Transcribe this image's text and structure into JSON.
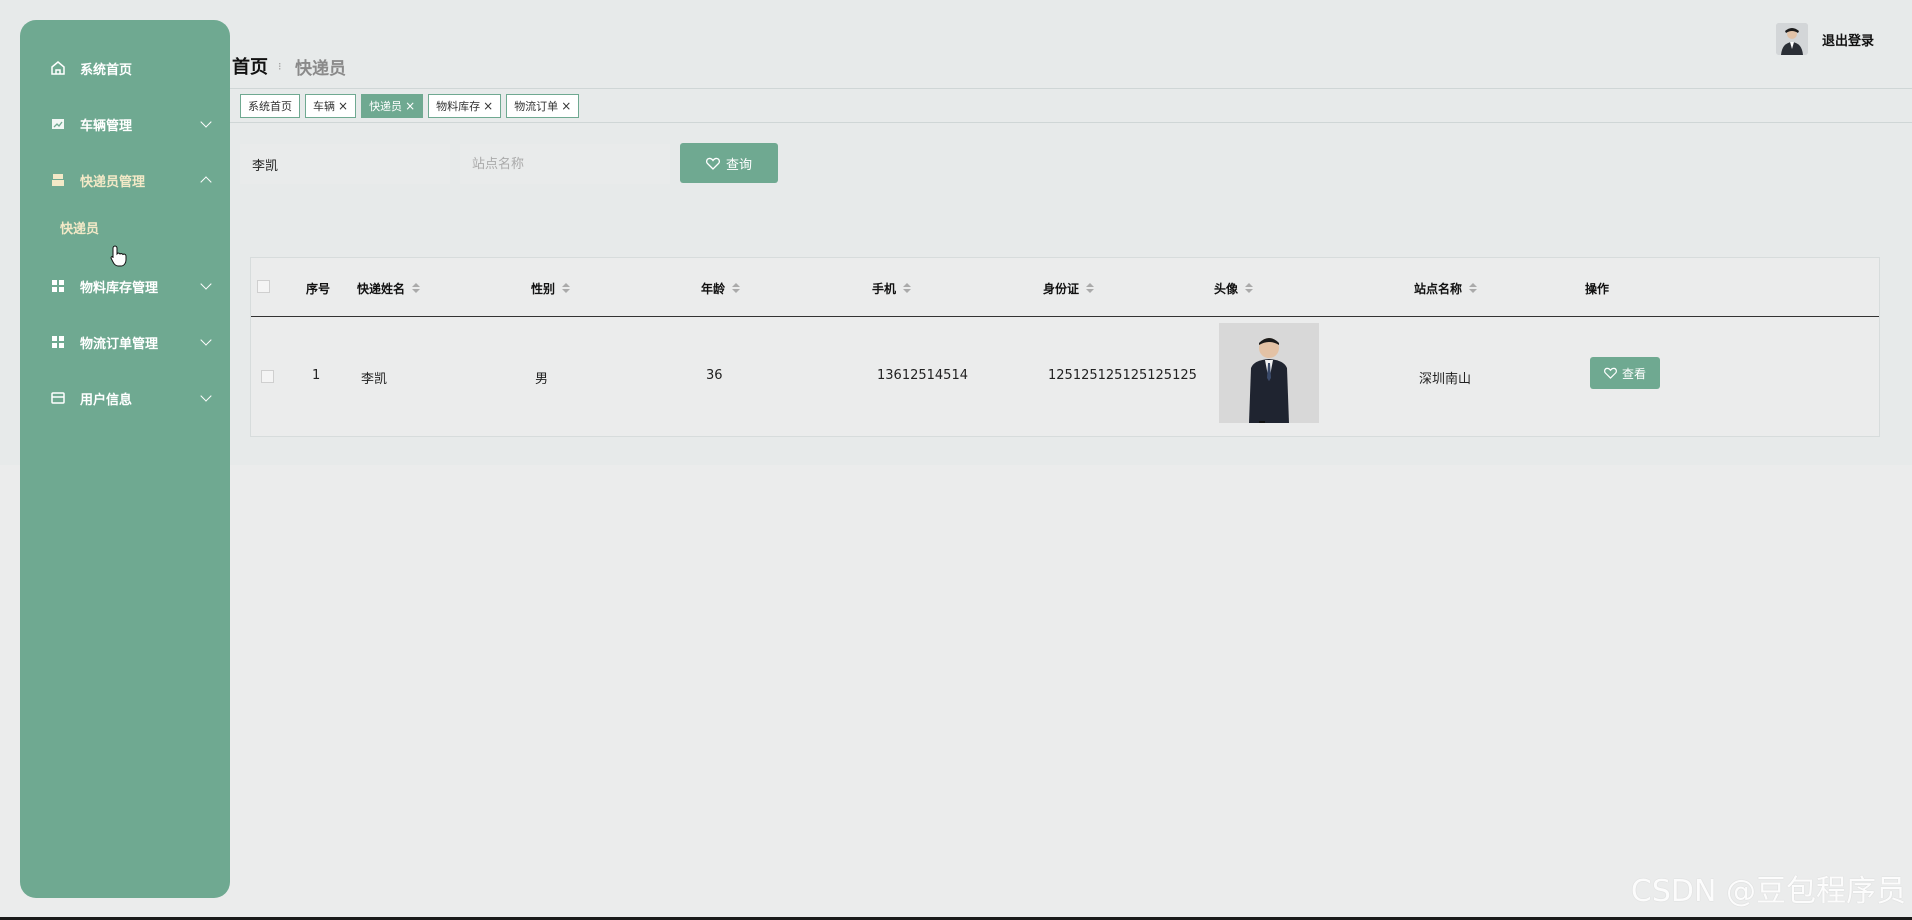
{
  "sidebar": {
    "items": [
      {
        "label": "系统首页",
        "icon": "home-icon"
      },
      {
        "label": "车辆管理",
        "icon": "chart-icon"
      },
      {
        "label": "快递员管理",
        "icon": "printer-icon"
      },
      {
        "label": "物料库存管理",
        "icon": "grid-icon"
      },
      {
        "label": "物流订单管理",
        "icon": "grid-icon"
      },
      {
        "label": "用户信息",
        "icon": "card-icon"
      }
    ],
    "sub_item": "快递员"
  },
  "header": {
    "breadcrumb_home": "首页",
    "breadcrumb_sep": "⁝",
    "breadcrumb_current": "快递员",
    "logout": "退出登录"
  },
  "tabs": [
    {
      "label": "系统首页",
      "closable": false,
      "active": false
    },
    {
      "label": "车辆",
      "closable": true,
      "active": false
    },
    {
      "label": "快递员",
      "closable": true,
      "active": true
    },
    {
      "label": "物料库存",
      "closable": true,
      "active": false
    },
    {
      "label": "物流订单",
      "closable": true,
      "active": false
    }
  ],
  "search": {
    "name_value": "李凯",
    "station_placeholder": "站点名称",
    "query_label": "查询"
  },
  "table": {
    "columns": [
      "序号",
      "快递姓名",
      "性别",
      "年龄",
      "手机",
      "身份证",
      "头像",
      "站点名称",
      "操作"
    ],
    "rows": [
      {
        "index": "1",
        "name": "李凯",
        "gender": "男",
        "age": "36",
        "phone": "13612514514",
        "id_card": "125125125125125125",
        "station": "深圳南山",
        "action": "查看"
      }
    ]
  },
  "watermark": "CSDN @豆包程序员",
  "colors": {
    "accent": "#6fa991",
    "active_text": "#f3e9c7"
  }
}
